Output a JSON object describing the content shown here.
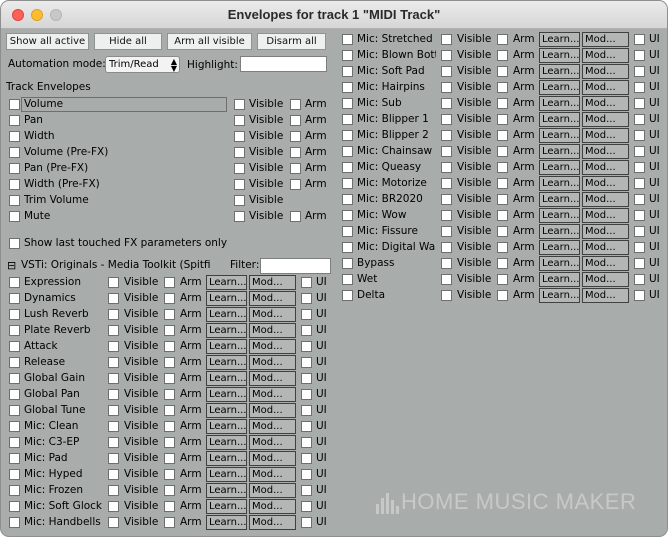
{
  "window": {
    "title": "Envelopes for track 1 \"MIDI Track\""
  },
  "toolbar": {
    "show_all_active": "Show all active",
    "hide_all": "Hide all",
    "arm_all_visible": "Arm all visible",
    "disarm_all": "Disarm all",
    "automation_mode_label": "Automation mode:",
    "automation_mode_value": "Trim/Read",
    "highlight_label": "Highlight:",
    "highlight_value": ""
  },
  "track_envelopes": {
    "heading": "Track Envelopes",
    "visible_label": "Visible",
    "arm_label": "Arm",
    "items": [
      {
        "name": "Volume",
        "has_arm": true
      },
      {
        "name": "Pan",
        "has_arm": true
      },
      {
        "name": "Width",
        "has_arm": true
      },
      {
        "name": "Volume (Pre-FX)",
        "has_arm": true
      },
      {
        "name": "Pan (Pre-FX)",
        "has_arm": true
      },
      {
        "name": "Width (Pre-FX)",
        "has_arm": true
      },
      {
        "name": "Trim Volume",
        "has_arm": false
      },
      {
        "name": "Mute",
        "has_arm": true
      }
    ],
    "show_last_touched": "Show last touched FX parameters only"
  },
  "fx": {
    "expander": "⊟",
    "title": "VSTi: Originals - Media Toolkit (Spitfi",
    "filter_label": "Filter:",
    "filter_value": "",
    "visible_label": "Visible",
    "arm_label": "Arm",
    "learn_label": "Learn...",
    "mod_label": "Mod...",
    "ui_label": "UI",
    "left_params": [
      "Expression",
      "Dynamics",
      "Lush Reverb",
      "Plate Reverb",
      "Attack",
      "Release",
      "Global Gain",
      "Global Pan",
      "Global Tune",
      "Mic: Clean",
      "Mic: C3-EP",
      "Mic: Pad",
      "Mic: Hyped",
      "Mic: Frozen",
      "Mic: Soft Glock",
      "Mic: Handbells"
    ],
    "right_params": [
      "Mic: Stretched",
      "Mic: Blown Bottl",
      "Mic: Soft Pad",
      "Mic: Hairpins",
      "Mic: Sub",
      "Mic: Blipper 1",
      "Mic: Blipper 2",
      "Mic: Chainsaw",
      "Mic: Queasy",
      "Mic: Motorize",
      "Mic: BR2020",
      "Mic: Wow",
      "Mic: Fissure",
      "Mic: Digital Warp",
      "Bypass",
      "Wet",
      "Delta"
    ]
  },
  "watermark": "HOME MUSIC MAKER"
}
